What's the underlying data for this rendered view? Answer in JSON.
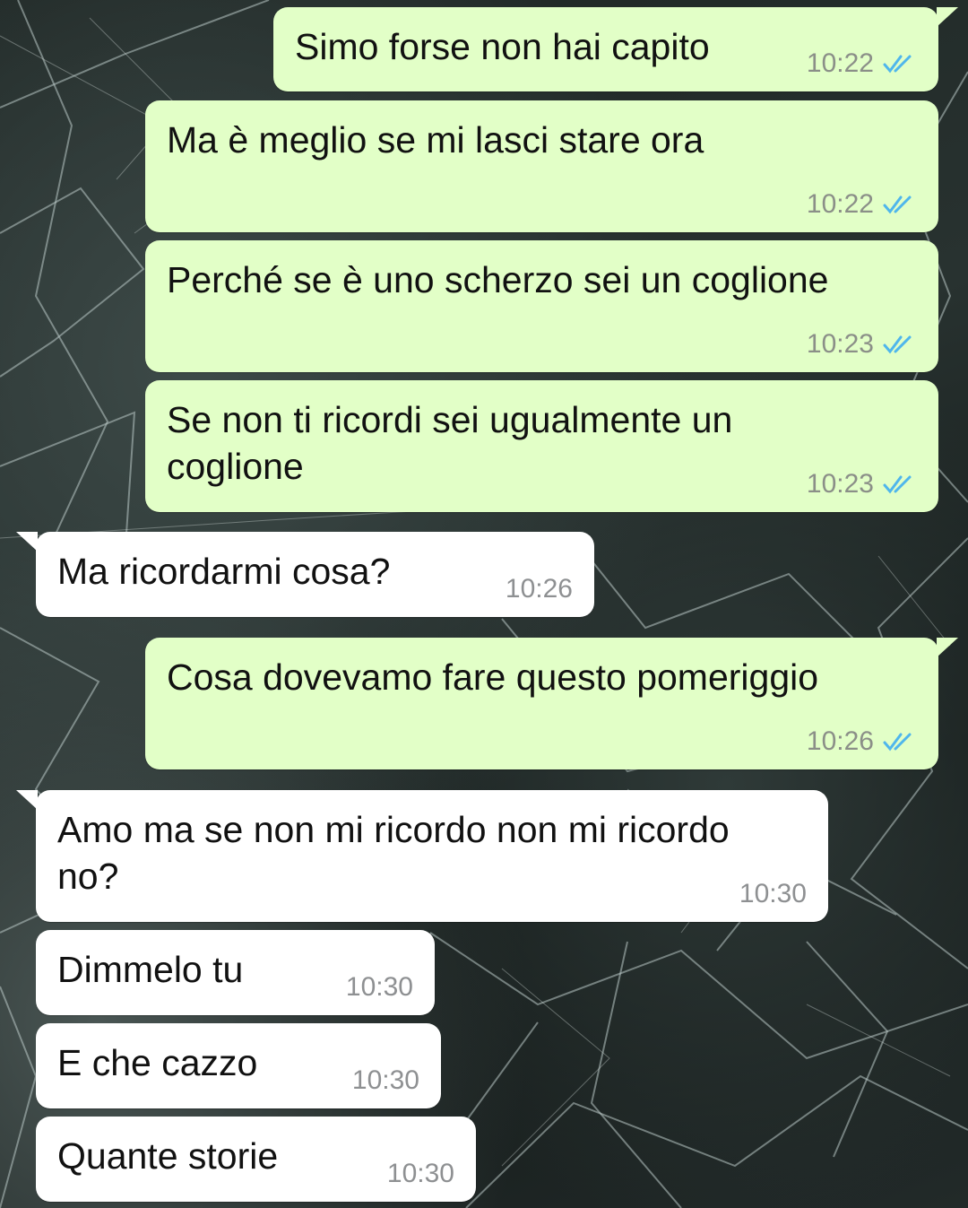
{
  "theme": {
    "outgoing_bubble": "#e2ffc7",
    "incoming_bubble": "#ffffff",
    "read_tick_color": "#4fb6ec"
  },
  "messages": [
    {
      "direction": "outgoing",
      "text": "Simo forse non hai capito",
      "time": "10:22",
      "status": "read"
    },
    {
      "direction": "outgoing",
      "text": "Ma è meglio se mi lasci stare ora",
      "time": "10:22",
      "status": "read"
    },
    {
      "direction": "outgoing",
      "text": "Perché se è uno scherzo sei un coglione",
      "time": "10:23",
      "status": "read"
    },
    {
      "direction": "outgoing",
      "text": "Se non ti ricordi sei ugualmente un\ncoglione",
      "time": "10:23",
      "status": "read"
    },
    {
      "direction": "incoming",
      "text": "Ma ricordarmi cosa?",
      "time": "10:26"
    },
    {
      "direction": "outgoing",
      "text": "Cosa dovevamo fare questo pomeriggio",
      "time": "10:26",
      "status": "read"
    },
    {
      "direction": "incoming",
      "text": "Amo ma se non mi ricordo non mi ricordo\nno?",
      "time": "10:30"
    },
    {
      "direction": "incoming",
      "text": "Dimmelo tu",
      "time": "10:30"
    },
    {
      "direction": "incoming",
      "text": "E che cazzo",
      "time": "10:30"
    },
    {
      "direction": "incoming",
      "text": "Quante storie",
      "time": "10:30"
    }
  ]
}
